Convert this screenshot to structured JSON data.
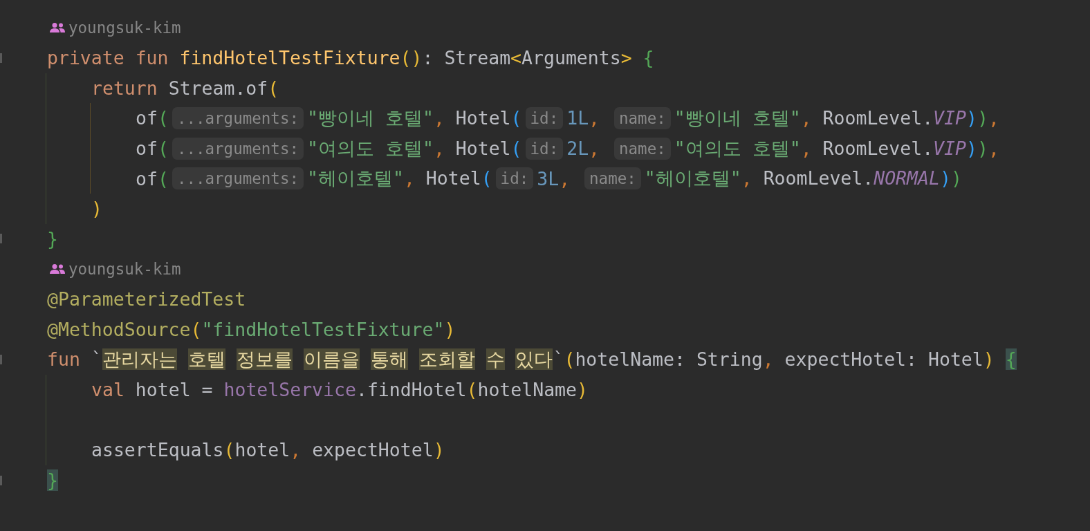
{
  "editor": {
    "lines": [
      {
        "kind": "author",
        "author": "youngsuk-kim"
      },
      {
        "kind": "code",
        "fold": true,
        "tokens": [
          {
            "t": "private fun ",
            "kind": "kw"
          },
          {
            "t": "findHotelTestFixture",
            "kind": "fn"
          },
          {
            "t": "()",
            "kind": "p1"
          },
          {
            "t": ": Stream",
            "kind": "id"
          },
          {
            "t": "<",
            "kind": "p1"
          },
          {
            "t": "Arguments",
            "kind": "id"
          },
          {
            "t": ">",
            "kind": "p1"
          },
          {
            "kind": "space"
          },
          {
            "t": "{",
            "kind": "p2"
          }
        ]
      },
      {
        "kind": "code",
        "fold": false,
        "tokens": [
          {
            "kind": "guide"
          },
          {
            "t": "return ",
            "kind": "kw"
          },
          {
            "t": "Stream.of",
            "kind": "id"
          },
          {
            "t": "(",
            "kind": "p1"
          }
        ]
      },
      {
        "kind": "code",
        "fold": false,
        "tokens": [
          {
            "kind": "guide"
          },
          {
            "kind": "guide"
          },
          {
            "t": "of",
            "kind": "id"
          },
          {
            "t": "(",
            "kind": "p2"
          },
          {
            "t": "...arguments:",
            "kind": "hint"
          },
          {
            "t": "\"빵이네 호텔\"",
            "kind": "str"
          },
          {
            "t": ", ",
            "kind": "comma"
          },
          {
            "t": "Hotel",
            "kind": "id"
          },
          {
            "t": "(",
            "kind": "p3"
          },
          {
            "t": "id:",
            "kind": "hint"
          },
          {
            "t": "1L",
            "kind": "num"
          },
          {
            "t": ", ",
            "kind": "comma"
          },
          {
            "t": "name:",
            "kind": "hint"
          },
          {
            "t": "\"빵이네 호텔\"",
            "kind": "str"
          },
          {
            "t": ", ",
            "kind": "comma"
          },
          {
            "t": "RoomLevel.",
            "kind": "id"
          },
          {
            "t": "VIP",
            "kind": "const"
          },
          {
            "t": ")",
            "kind": "p3"
          },
          {
            "t": ")",
            "kind": "p2"
          },
          {
            "t": ",",
            "kind": "comma"
          }
        ]
      },
      {
        "kind": "code",
        "fold": false,
        "tokens": [
          {
            "kind": "guide"
          },
          {
            "kind": "guide"
          },
          {
            "t": "of",
            "kind": "id"
          },
          {
            "t": "(",
            "kind": "p2"
          },
          {
            "t": "...arguments:",
            "kind": "hint"
          },
          {
            "t": "\"여의도 호텔\"",
            "kind": "str"
          },
          {
            "t": ", ",
            "kind": "comma"
          },
          {
            "t": "Hotel",
            "kind": "id"
          },
          {
            "t": "(",
            "kind": "p3"
          },
          {
            "t": "id:",
            "kind": "hint"
          },
          {
            "t": "2L",
            "kind": "num"
          },
          {
            "t": ", ",
            "kind": "comma"
          },
          {
            "t": "name:",
            "kind": "hint"
          },
          {
            "t": "\"여의도 호텔\"",
            "kind": "str"
          },
          {
            "t": ", ",
            "kind": "comma"
          },
          {
            "t": "RoomLevel.",
            "kind": "id"
          },
          {
            "t": "VIP",
            "kind": "const"
          },
          {
            "t": ")",
            "kind": "p3"
          },
          {
            "t": ")",
            "kind": "p2"
          },
          {
            "t": ",",
            "kind": "comma"
          }
        ]
      },
      {
        "kind": "code",
        "fold": false,
        "tokens": [
          {
            "kind": "guide"
          },
          {
            "kind": "guide"
          },
          {
            "t": "of",
            "kind": "id"
          },
          {
            "t": "(",
            "kind": "p2"
          },
          {
            "t": "...arguments:",
            "kind": "hint"
          },
          {
            "t": "\"헤이호텔\"",
            "kind": "str"
          },
          {
            "t": ", ",
            "kind": "comma"
          },
          {
            "t": "Hotel",
            "kind": "id"
          },
          {
            "t": "(",
            "kind": "p3"
          },
          {
            "t": "id:",
            "kind": "hint"
          },
          {
            "t": "3L",
            "kind": "num"
          },
          {
            "t": ", ",
            "kind": "comma"
          },
          {
            "t": "name:",
            "kind": "hint"
          },
          {
            "t": "\"헤이호텔\"",
            "kind": "str"
          },
          {
            "t": ", ",
            "kind": "comma"
          },
          {
            "t": "RoomLevel.",
            "kind": "id"
          },
          {
            "t": "NORMAL",
            "kind": "const"
          },
          {
            "t": ")",
            "kind": "p3"
          },
          {
            "t": ")",
            "kind": "p2"
          }
        ]
      },
      {
        "kind": "code",
        "fold": false,
        "tokens": [
          {
            "kind": "guide"
          },
          {
            "t": ")",
            "kind": "p1"
          }
        ]
      },
      {
        "kind": "code",
        "fold": true,
        "tokens": [
          {
            "t": "}",
            "kind": "p2"
          }
        ]
      },
      {
        "kind": "author",
        "author": "youngsuk-kim"
      },
      {
        "kind": "code",
        "fold": false,
        "tokens": [
          {
            "t": "@ParameterizedTest",
            "kind": "ann"
          }
        ]
      },
      {
        "kind": "code",
        "fold": false,
        "tokens": [
          {
            "t": "@MethodSource",
            "kind": "ann"
          },
          {
            "t": "(",
            "kind": "p1"
          },
          {
            "t": "\"findHotelTestFixture\"",
            "kind": "str"
          },
          {
            "t": ")",
            "kind": "p1"
          }
        ]
      },
      {
        "kind": "code",
        "fold": true,
        "tokens": [
          {
            "t": "fun ",
            "kind": "kw"
          },
          {
            "t": "`",
            "kind": "id"
          },
          {
            "t": "관리자는",
            "kind": "hl"
          },
          {
            "kind": "space"
          },
          {
            "t": "호텔",
            "kind": "hl"
          },
          {
            "kind": "space"
          },
          {
            "t": "정보를",
            "kind": "hl"
          },
          {
            "kind": "space"
          },
          {
            "t": "이름을",
            "kind": "hl"
          },
          {
            "kind": "space"
          },
          {
            "t": "통해",
            "kind": "hl"
          },
          {
            "kind": "space"
          },
          {
            "t": "조회할",
            "kind": "hl"
          },
          {
            "kind": "space"
          },
          {
            "t": "수",
            "kind": "hl"
          },
          {
            "kind": "space"
          },
          {
            "t": "있다",
            "kind": "hl"
          },
          {
            "t": "`",
            "kind": "id"
          },
          {
            "t": "(",
            "kind": "p1"
          },
          {
            "t": "hotelName: String",
            "kind": "id"
          },
          {
            "t": ", ",
            "kind": "comma"
          },
          {
            "t": "expectHotel: Hotel",
            "kind": "id"
          },
          {
            "t": ")",
            "kind": "p1"
          },
          {
            "kind": "space"
          },
          {
            "t": "{",
            "kind": "match"
          }
        ]
      },
      {
        "kind": "code",
        "fold": false,
        "tokens": [
          {
            "kind": "guide"
          },
          {
            "t": "val ",
            "kind": "kw"
          },
          {
            "t": "hotel = ",
            "kind": "id"
          },
          {
            "t": "hotelService",
            "kind": "field"
          },
          {
            "t": ".findHotel",
            "kind": "id"
          },
          {
            "t": "(",
            "kind": "p1"
          },
          {
            "t": "hotelName",
            "kind": "id"
          },
          {
            "t": ")",
            "kind": "p1"
          }
        ]
      },
      {
        "kind": "code",
        "fold": false,
        "tokens": [
          {
            "kind": "guide"
          }
        ]
      },
      {
        "kind": "code",
        "fold": false,
        "tokens": [
          {
            "kind": "guide"
          },
          {
            "t": "assertEquals",
            "kind": "id"
          },
          {
            "t": "(",
            "kind": "p1"
          },
          {
            "t": "hotel",
            "kind": "id"
          },
          {
            "t": ", ",
            "kind": "comma"
          },
          {
            "t": "expectHotel",
            "kind": "id"
          },
          {
            "t": ")",
            "kind": "p1"
          }
        ]
      },
      {
        "kind": "code",
        "fold": true,
        "tokens": [
          {
            "t": "}",
            "kind": "match"
          }
        ]
      }
    ]
  }
}
